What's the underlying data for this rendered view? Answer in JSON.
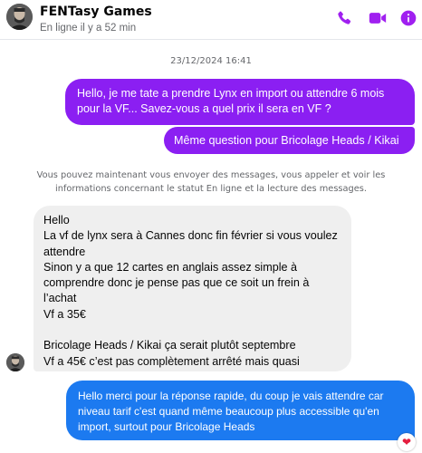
{
  "header": {
    "title": "FENTasy Games",
    "status": "En ligne il y a 52 min",
    "icons": [
      "phone-icon",
      "video-icon",
      "info-icon"
    ],
    "accent_color": "#a020f0"
  },
  "conversation": {
    "date_separator": "23/12/2024 16:41",
    "notice": "Vous pouvez maintenant vous envoyer des messages, vous appeler et voir les informations concernant le statut En ligne et la lecture des messages.",
    "messages": [
      {
        "sender": "me",
        "text": "Hello, je me tate a prendre Lynx en import ou attendre  6 mois pour la VF... Savez-vous a quel prix il sera en VF ?",
        "color": "#8b1ff2"
      },
      {
        "sender": "me",
        "text": "Même question pour Bricolage Heads / Kikai",
        "color": "#8b1ff2"
      },
      {
        "sender": "FENTasy Games",
        "text": "Hello\nLa vf de lynx sera à Cannes donc fin février si vous voulez attendre\nSinon y a que 12 cartes en anglais assez simple à comprendre donc je pense pas que ce soit un frein à l’achat\nVf a 35€\n\nBricolage Heads / Kikai ça serait plutôt septembre\nVf a 45€ c’est pas complètement arrêté mais quasi",
        "color": "#efefef"
      },
      {
        "sender": "me",
        "text": "Hello merci pour la réponse rapide, du coup je vais attendre car niveau tarif c'est quand même beaucoup plus accessible qu'en import, surtout pour Bricolage Heads",
        "color": "#1c7af0",
        "reaction": "❤"
      }
    ]
  }
}
